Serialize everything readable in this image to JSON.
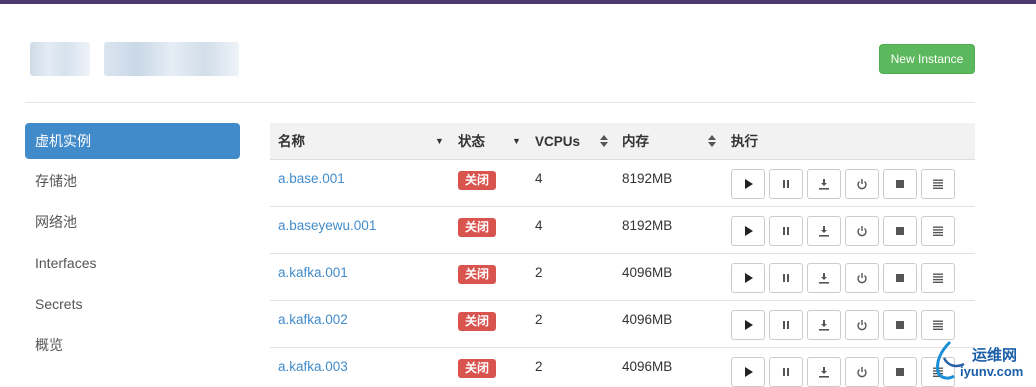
{
  "header": {
    "new_instance_label": "New Instance"
  },
  "sidebar": {
    "items": [
      {
        "label": "虚机实例",
        "active": true
      },
      {
        "label": "存储池",
        "active": false
      },
      {
        "label": "网络池",
        "active": false
      },
      {
        "label": "Interfaces",
        "active": false
      },
      {
        "label": "Secrets",
        "active": false
      },
      {
        "label": "概览",
        "active": false
      }
    ]
  },
  "table": {
    "columns": {
      "name": "名称",
      "status": "状态",
      "vcpus": "VCPUs",
      "memory": "内存",
      "actions": "执行"
    },
    "rows": [
      {
        "name": "a.base.001",
        "status": "关闭",
        "vcpus": "4",
        "memory": "8192MB"
      },
      {
        "name": "a.baseyewu.001",
        "status": "关闭",
        "vcpus": "4",
        "memory": "8192MB"
      },
      {
        "name": "a.kafka.001",
        "status": "关闭",
        "vcpus": "2",
        "memory": "4096MB"
      },
      {
        "name": "a.kafka.002",
        "status": "关闭",
        "vcpus": "2",
        "memory": "4096MB"
      },
      {
        "name": "a.kafka.003",
        "status": "关闭",
        "vcpus": "2",
        "memory": "4096MB"
      }
    ],
    "action_icons": [
      "play-icon",
      "pause-icon",
      "download-icon",
      "power-icon",
      "stop-icon",
      "menu-icon"
    ]
  },
  "watermark": {
    "line1": "运维网",
    "line2": "iyunv.com"
  },
  "colors": {
    "accent": "#428bca",
    "success": "#5cb85c",
    "danger": "#d9534f",
    "topbar": "#4b3a6b"
  }
}
